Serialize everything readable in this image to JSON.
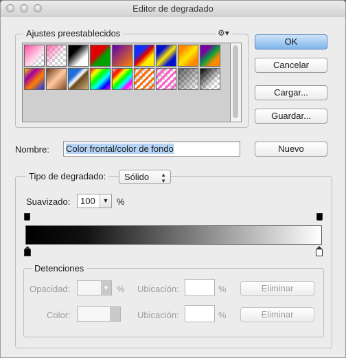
{
  "window": {
    "title": "Editor de degradado"
  },
  "presets": {
    "legend": "Ajustes preestablecidos",
    "gear_icon": "gear-icon"
  },
  "buttons": {
    "ok": "OK",
    "cancel": "Cancelar",
    "load": "Cargar...",
    "save": "Guardar...",
    "new": "Nuevo"
  },
  "name": {
    "label": "Nombre:",
    "value": "Color frontal/color de fondo"
  },
  "gradient_type": {
    "label": "Tipo de degradado:",
    "value": "Sólido"
  },
  "smoothness": {
    "label": "Suavizado:",
    "value": "100",
    "unit": "%"
  },
  "stops": {
    "legend": "Detenciones",
    "opacity_label": "Opacidad:",
    "opacity_unit": "%",
    "location_label": "Ubicación:",
    "location_unit": "%",
    "color_label": "Color:",
    "delete_label": "Eliminar"
  },
  "swatch_names": [
    "pink-to-transparent",
    "pink-checker",
    "black-to-white",
    "red-to-green",
    "violet-to-orange",
    "blue-red-yellow",
    "blue-yellow-blue",
    "orange-yellow-orange",
    "violet-green-orange",
    "yellow-violet-orange-blue",
    "copper",
    "chrome",
    "spectrum",
    "transparent-rainbow",
    "transparent-stripes",
    "pink-stripes",
    "neutral-density",
    "black-to-transparent"
  ]
}
